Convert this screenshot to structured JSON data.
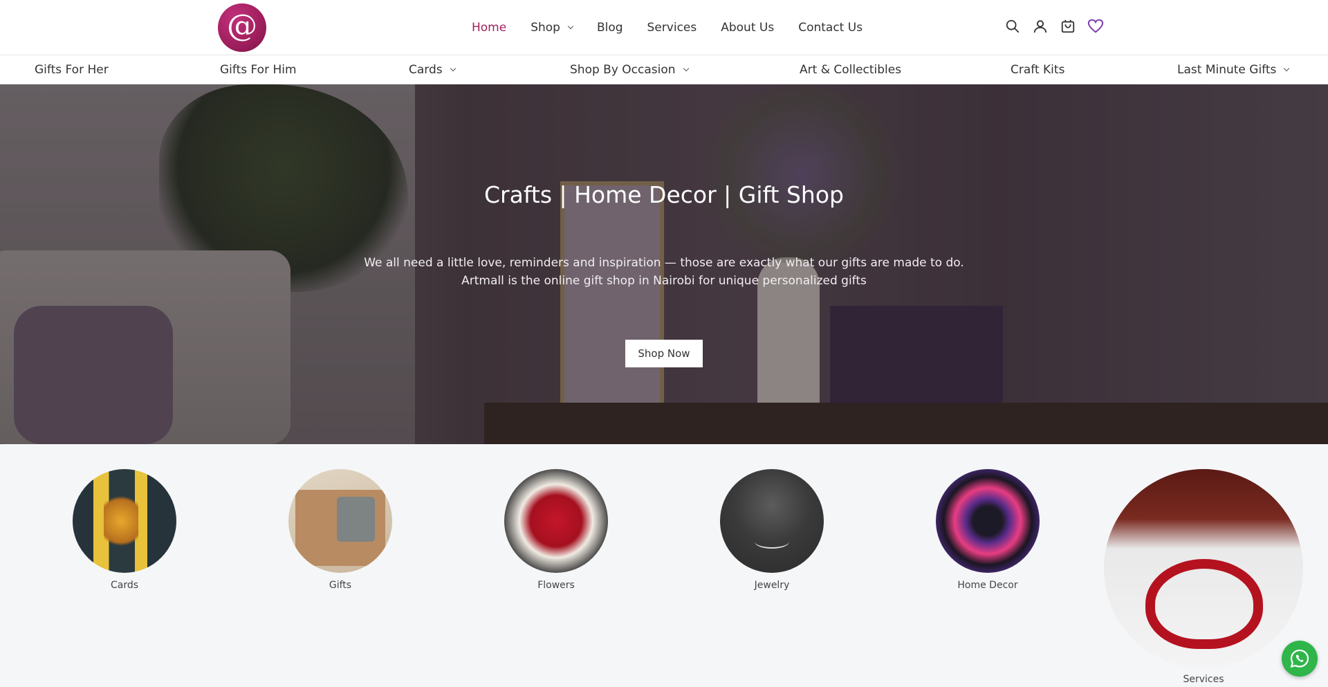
{
  "brand": {
    "logo_glyph": "@",
    "color": "#a2205f"
  },
  "main_nav": [
    {
      "label": "Home",
      "active": true
    },
    {
      "label": "Shop",
      "dropdown": true
    },
    {
      "label": "Blog"
    },
    {
      "label": "Services"
    },
    {
      "label": "About Us"
    },
    {
      "label": "Contact Us"
    }
  ],
  "header_icons": [
    "search-icon",
    "account-icon",
    "cart-icon",
    "wishlist-heart-icon"
  ],
  "category_nav": [
    {
      "label": "Gifts For Her"
    },
    {
      "label": "Gifts For Him"
    },
    {
      "label": "Cards",
      "dropdown": true
    },
    {
      "label": "Shop By Occasion",
      "dropdown": true
    },
    {
      "label": "Art & Collectibles"
    },
    {
      "label": "Craft Kits"
    },
    {
      "label": "Last Minute Gifts",
      "dropdown": true
    }
  ],
  "hero": {
    "title": "Crafts | Home Decor | Gift Shop",
    "text": "We all need a little love, reminders and inspiration — those are exactly what our gifts are made to do. Artmall is the online gift shop in Nairobi for unique personalized gifts",
    "button": "Shop Now"
  },
  "categories": [
    {
      "label": "Cards"
    },
    {
      "label": "Gifts"
    },
    {
      "label": "Flowers"
    },
    {
      "label": "Jewelry"
    },
    {
      "label": "Home Decor"
    },
    {
      "label": "Services"
    }
  ],
  "whatsapp": {
    "icon": "whatsapp-icon",
    "color": "#2fb54a"
  }
}
